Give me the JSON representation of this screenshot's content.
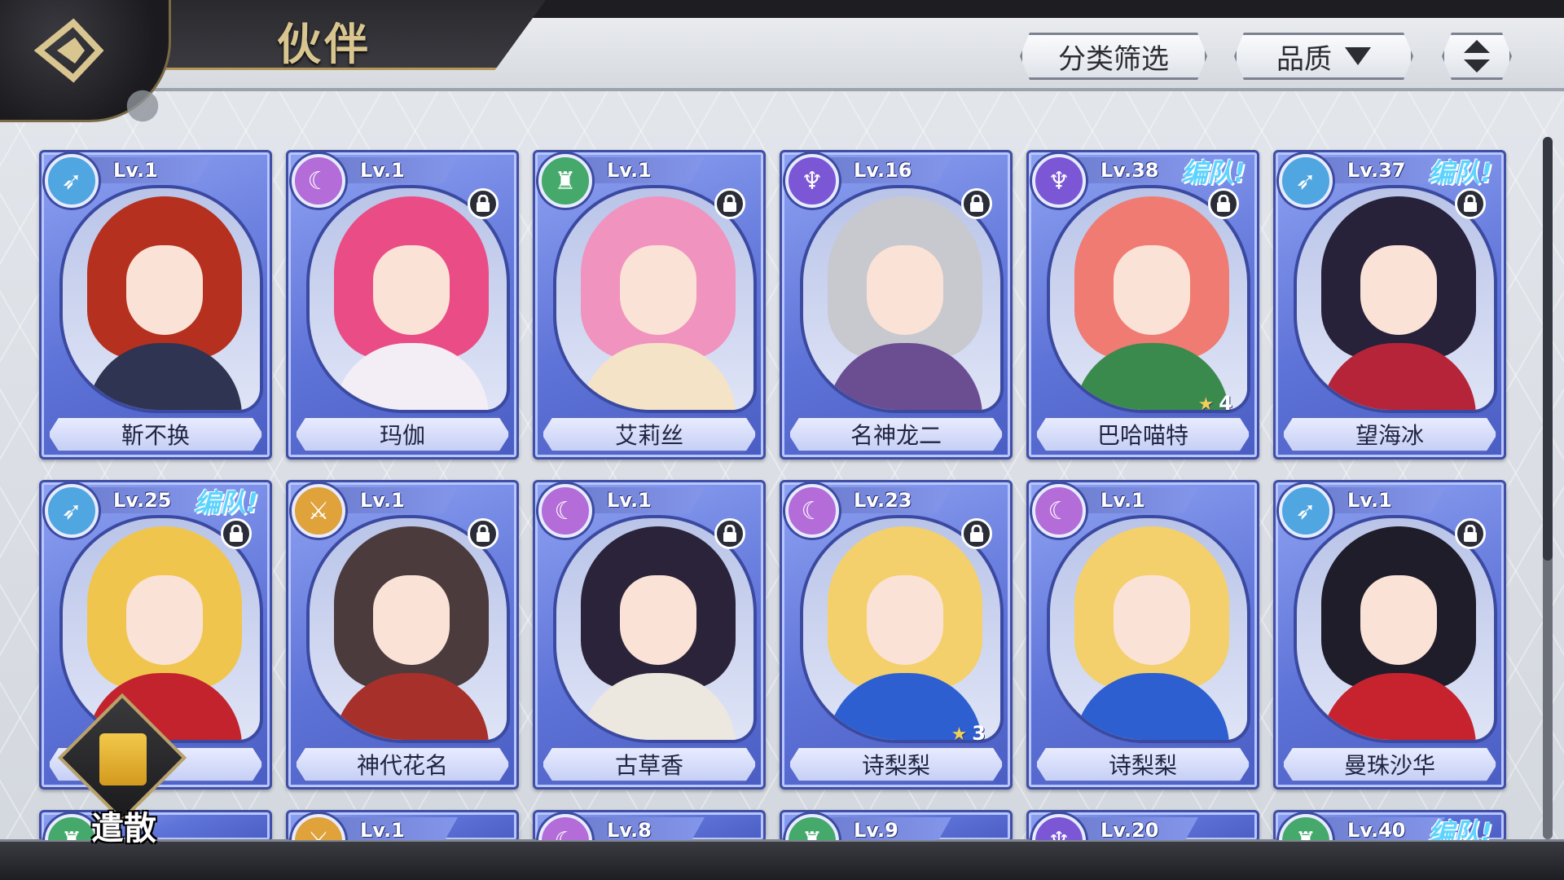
{
  "header": {
    "title": "伙伴",
    "filter_label": "分类筛选",
    "quality_label": "品质"
  },
  "dismiss": {
    "label": "遣散"
  },
  "colors": {
    "card_blue": "#6a7ee0",
    "team_tag": "#5fd3ff",
    "gold": "#d9c590"
  },
  "companions": [
    {
      "name": "靳不换",
      "level": "Lv.1",
      "class_icon": "bow-icon",
      "class_color": "#4fa6e0",
      "team": "",
      "locked": false,
      "stars": "",
      "hair": "#b5301f",
      "outfit": "#2e3452"
    },
    {
      "name": "玛伽",
      "level": "Lv.1",
      "class_icon": "crescent-icon",
      "class_color": "#b46cd8",
      "team": "",
      "locked": true,
      "stars": "",
      "hair": "#ea4d86",
      "outfit": "#f3eef5"
    },
    {
      "name": "艾莉丝",
      "level": "Lv.1",
      "class_icon": "totem-icon",
      "class_color": "#45a96b",
      "team": "",
      "locked": true,
      "stars": "",
      "hair": "#f093bf",
      "outfit": "#f4e3c6"
    },
    {
      "name": "名神龙二",
      "level": "Lv.16",
      "class_icon": "trident-icon",
      "class_color": "#7b57d6",
      "team": "",
      "locked": true,
      "stars": "",
      "hair": "#c8c9cf",
      "outfit": "#6b4d92"
    },
    {
      "name": "巴哈喵特",
      "level": "Lv.38",
      "class_icon": "trident-icon",
      "class_color": "#7b57d6",
      "team": "编队!",
      "locked": true,
      "stars": "4",
      "hair": "#f07b72",
      "outfit": "#3a8a4e"
    },
    {
      "name": "望海冰",
      "level": "Lv.37",
      "class_icon": "bow-icon",
      "class_color": "#4fa6e0",
      "team": "编队!",
      "locked": true,
      "stars": "",
      "hair": "#27213a",
      "outfit": "#b6243a"
    },
    {
      "name": "",
      "level": "Lv.25",
      "class_icon": "bow-icon",
      "class_color": "#4fa6e0",
      "team": "编队!",
      "locked": true,
      "stars": "",
      "hair": "#f0c54e",
      "outfit": "#c3232d"
    },
    {
      "name": "神代花名",
      "level": "Lv.1",
      "class_icon": "swords-icon",
      "class_color": "#e0a23a",
      "team": "",
      "locked": true,
      "stars": "",
      "hair": "#4b3b3d",
      "outfit": "#a8302a"
    },
    {
      "name": "古草香",
      "level": "Lv.1",
      "class_icon": "crescent-icon",
      "class_color": "#b46cd8",
      "team": "",
      "locked": true,
      "stars": "",
      "hair": "#2b2339",
      "outfit": "#ece7df"
    },
    {
      "name": "诗梨梨",
      "level": "Lv.23",
      "class_icon": "crescent-icon",
      "class_color": "#b46cd8",
      "team": "",
      "locked": true,
      "stars": "3",
      "hair": "#f3d06b",
      "outfit": "#2d5fd0"
    },
    {
      "name": "诗梨梨",
      "level": "Lv.1",
      "class_icon": "crescent-icon",
      "class_color": "#b46cd8",
      "team": "",
      "locked": false,
      "stars": "",
      "hair": "#f3d06b",
      "outfit": "#2d5fd0"
    },
    {
      "name": "曼珠沙华",
      "level": "Lv.1",
      "class_icon": "bow-icon",
      "class_color": "#4fa6e0",
      "team": "",
      "locked": true,
      "stars": "",
      "hair": "#1f1d2a",
      "outfit": "#c6232f"
    }
  ],
  "partial_row": [
    {
      "level": "",
      "class_icon": "totem-icon",
      "class_color": "#45a96b",
      "team": ""
    },
    {
      "level": "Lv.1",
      "class_icon": "swords-icon",
      "class_color": "#e0a23a",
      "team": ""
    },
    {
      "level": "Lv.8",
      "class_icon": "crescent-icon",
      "class_color": "#b46cd8",
      "team": ""
    },
    {
      "level": "Lv.9",
      "class_icon": "totem-icon",
      "class_color": "#45a96b",
      "team": ""
    },
    {
      "level": "Lv.20",
      "class_icon": "trident-icon",
      "class_color": "#7b57d6",
      "team": ""
    },
    {
      "level": "Lv.40",
      "class_icon": "totem-icon",
      "class_color": "#45a96b",
      "team": "编队!"
    }
  ]
}
